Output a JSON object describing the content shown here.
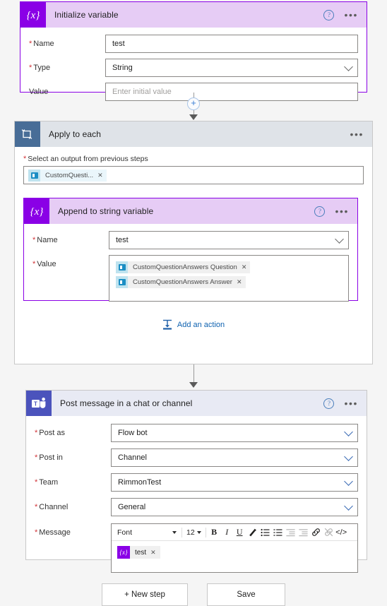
{
  "cards": {
    "initialize_variable": {
      "title": "Initialize variable",
      "icon": "variable-braces-icon",
      "help": "?",
      "more": "•••",
      "fields": [
        {
          "label": "Name",
          "required": true,
          "value": "test",
          "placeholder": "",
          "control": "text"
        },
        {
          "label": "Type",
          "required": true,
          "value": "String",
          "placeholder": "",
          "control": "select"
        },
        {
          "label": "Value",
          "required": false,
          "value": "",
          "placeholder": "Enter initial value",
          "control": "text"
        }
      ]
    },
    "apply_to_each": {
      "title": "Apply to each",
      "icon": "loop-foreach-icon",
      "more": "•••",
      "select_label": "Select an output from previous steps",
      "select_required": true,
      "select_token": "CustomQuesti...",
      "add_action_label": "Add an action"
    },
    "append_to_string": {
      "title": "Append to string variable",
      "icon": "variable-braces-icon",
      "help": "?",
      "more": "•••",
      "name_label": "Name",
      "name_value": "test",
      "value_label": "Value",
      "value_tokens": [
        "CustomQuestionAnswers Question",
        "CustomQuestionAnswers Answer"
      ]
    },
    "post_message": {
      "title": "Post message in a chat or channel",
      "icon": "microsoft-teams-icon",
      "help": "?",
      "more": "•••",
      "fields": [
        {
          "label": "Post as",
          "required": true,
          "value": "Flow bot"
        },
        {
          "label": "Post in",
          "required": true,
          "value": "Channel"
        },
        {
          "label": "Team",
          "required": true,
          "value": "RimmonTest"
        },
        {
          "label": "Channel",
          "required": true,
          "value": "General"
        }
      ],
      "message_label": "Message",
      "message_required": true,
      "editor": {
        "font_name": "Font",
        "font_size": "12",
        "buttons": [
          {
            "name": "bold-icon",
            "glyph": "B",
            "disabled": false
          },
          {
            "name": "italic-icon",
            "glyph": "I",
            "disabled": false
          },
          {
            "name": "underline-icon",
            "glyph": "U",
            "disabled": false
          },
          {
            "name": "font-color-icon",
            "glyph": "✐",
            "disabled": false
          },
          {
            "name": "numbered-list-icon",
            "glyph": "",
            "disabled": false
          },
          {
            "name": "bulleted-list-icon",
            "glyph": "",
            "disabled": false
          },
          {
            "name": "decrease-indent-icon",
            "glyph": "",
            "disabled": true
          },
          {
            "name": "increase-indent-icon",
            "glyph": "",
            "disabled": true
          },
          {
            "name": "link-icon",
            "glyph": "🔗",
            "disabled": false
          },
          {
            "name": "unlink-icon",
            "glyph": "🔗",
            "disabled": true
          },
          {
            "name": "code-view-icon",
            "glyph": "</>",
            "disabled": false
          }
        ],
        "body_token": "test"
      }
    }
  },
  "connectors": {
    "add_step_plus": "+"
  },
  "footer": {
    "new_step_label": "+ New step",
    "save_label": "Save"
  },
  "colors": {
    "variable_purple": "#8a00e6",
    "loop_blue": "#486d97",
    "teams_indigo": "#4b53bc",
    "link_blue": "#0f62b0",
    "required_red": "#d13438",
    "page_background": "#f5f5f5"
  }
}
